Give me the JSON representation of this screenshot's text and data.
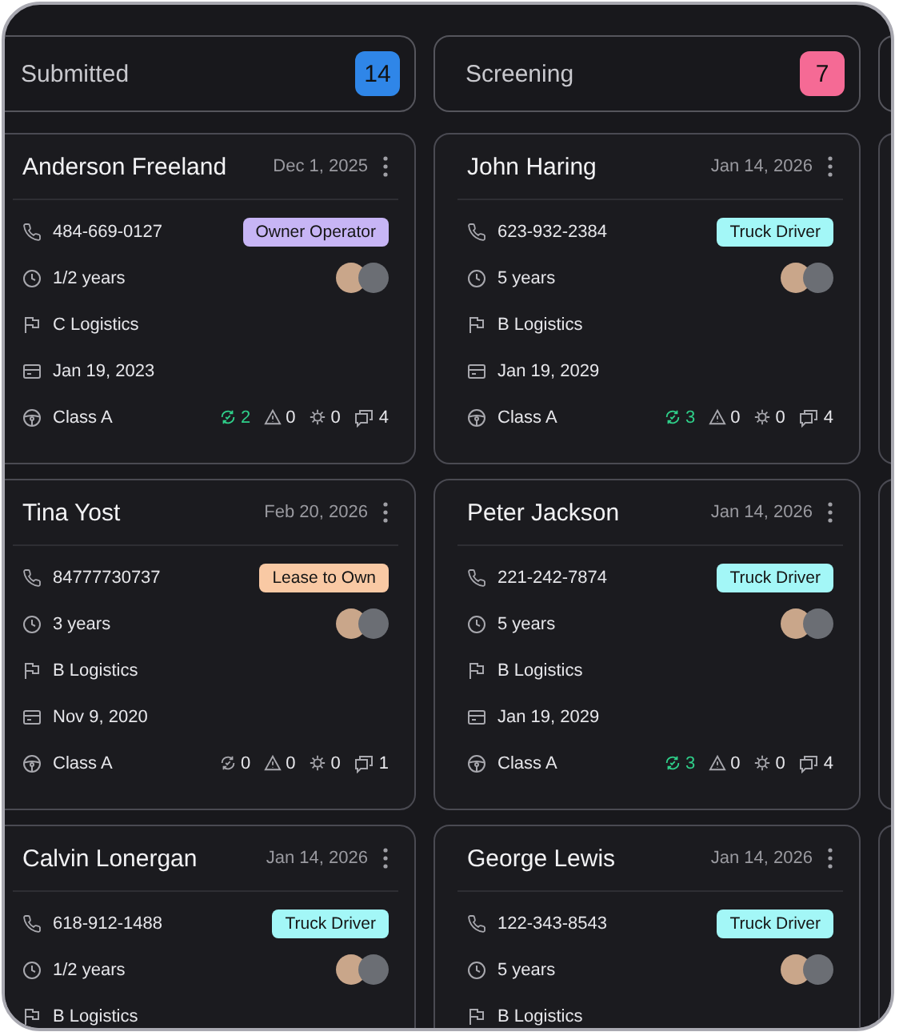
{
  "columns": [
    {
      "title": "Submitted",
      "count": "14",
      "color": "#2f86e8",
      "cards": [
        {
          "name": "Anderson Freeland",
          "date": "Dec 1, 2025",
          "phone": "484-669-0127",
          "badge": {
            "label": "Owner Operator",
            "color": "#c7b5f5"
          },
          "experience": "1/2 years",
          "company": "C Logistics",
          "license_date": "Jan 19, 2023",
          "license_class": "Class A",
          "stats": [
            {
              "kind": "approved",
              "value": "2",
              "active": true
            },
            {
              "kind": "warning",
              "value": "0",
              "active": false
            },
            {
              "kind": "issue",
              "value": "0",
              "active": false
            },
            {
              "kind": "comments",
              "value": "4",
              "active": false
            }
          ]
        },
        {
          "name": "Tina Yost",
          "date": "Feb 20, 2026",
          "phone": "84777730737",
          "badge": {
            "label": "Lease to Own",
            "color": "#f9c9a4"
          },
          "experience": "3 years",
          "company": "B Logistics",
          "license_date": "Nov 9, 2020",
          "license_class": "Class A",
          "stats": [
            {
              "kind": "approved",
              "value": "0",
              "active": false
            },
            {
              "kind": "warning",
              "value": "0",
              "active": false
            },
            {
              "kind": "issue",
              "value": "0",
              "active": false
            },
            {
              "kind": "comments",
              "value": "1",
              "active": false
            }
          ]
        },
        {
          "name": "Calvin Lonergan",
          "date": "Jan 14, 2026",
          "phone": "618-912-1488",
          "badge": {
            "label": "Truck Driver",
            "color": "#a3f7f7"
          },
          "experience": "1/2 years",
          "company": "B Logistics"
        }
      ]
    },
    {
      "title": "Screening",
      "count": "7",
      "color": "#f56a95",
      "cards": [
        {
          "name": "John Haring",
          "date": "Jan 14, 2026",
          "phone": "623-932-2384",
          "badge": {
            "label": "Truck Driver",
            "color": "#a3f7f7"
          },
          "experience": "5 years",
          "company": "B Logistics",
          "license_date": "Jan 19, 2029",
          "license_class": "Class A",
          "stats": [
            {
              "kind": "approved",
              "value": "3",
              "active": true
            },
            {
              "kind": "warning",
              "value": "0",
              "active": false
            },
            {
              "kind": "issue",
              "value": "0",
              "active": false
            },
            {
              "kind": "comments",
              "value": "4",
              "active": false
            }
          ]
        },
        {
          "name": "Peter Jackson",
          "date": "Jan 14, 2026",
          "phone": "221-242-7874",
          "badge": {
            "label": "Truck Driver",
            "color": "#a3f7f7"
          },
          "experience": "5 years",
          "company": "B Logistics",
          "license_date": "Jan 19, 2029",
          "license_class": "Class A",
          "stats": [
            {
              "kind": "approved",
              "value": "3",
              "active": true
            },
            {
              "kind": "warning",
              "value": "0",
              "active": false
            },
            {
              "kind": "issue",
              "value": "0",
              "active": false
            },
            {
              "kind": "comments",
              "value": "4",
              "active": false
            }
          ]
        },
        {
          "name": "George Lewis",
          "date": "Jan 14, 2026",
          "phone": "122-343-8543",
          "badge": {
            "label": "Truck Driver",
            "color": "#a3f7f7"
          },
          "experience": "5 years",
          "company": "B Logistics"
        }
      ]
    }
  ]
}
